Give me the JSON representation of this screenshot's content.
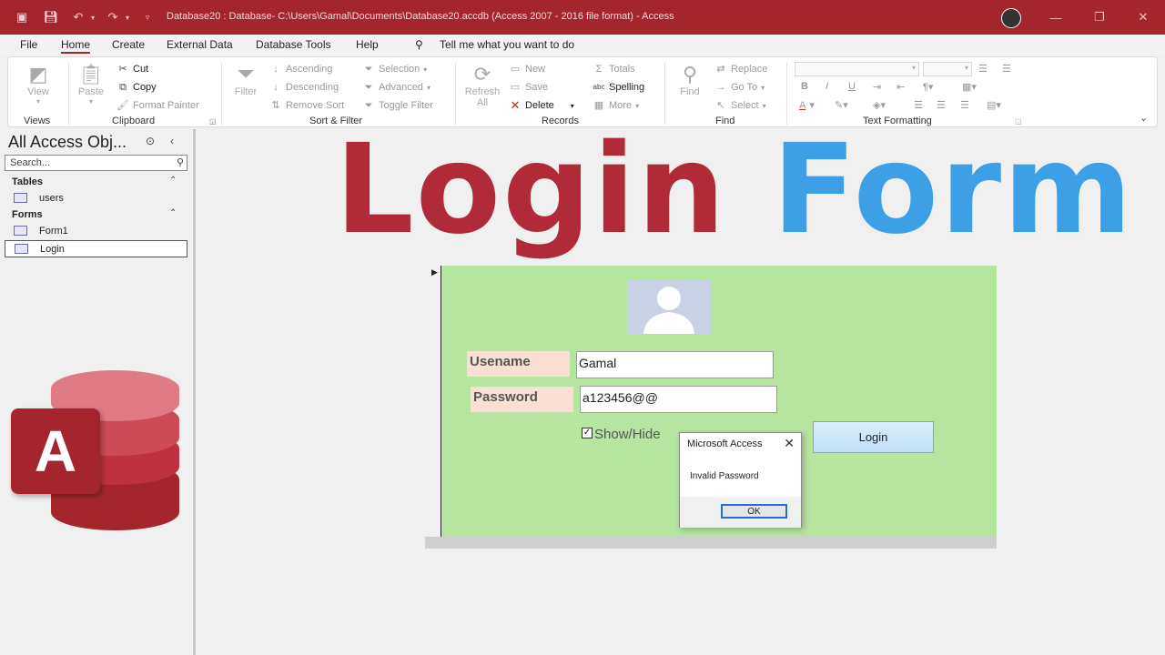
{
  "titlebar": {
    "title": "Database20 : Database- C:\\Users\\Gamal\\Documents\\Database20.accdb (Access 2007 - 2016 file format)  -  Access"
  },
  "menu": {
    "items": [
      "File",
      "Home",
      "Create",
      "External Data",
      "Database Tools",
      "Help"
    ],
    "tell_me": "Tell me what you want to do"
  },
  "ribbon": {
    "views": {
      "view": "View",
      "group": "Views"
    },
    "clipboard": {
      "paste": "Paste",
      "cut": "Cut",
      "copy": "Copy",
      "format_painter": "Format Painter",
      "group": "Clipboard"
    },
    "sort_filter": {
      "filter": "Filter",
      "ascending": "Ascending",
      "descending": "Descending",
      "remove_sort": "Remove Sort",
      "selection": "Selection",
      "advanced": "Advanced",
      "toggle_filter": "Toggle Filter",
      "group": "Sort & Filter"
    },
    "records": {
      "refresh": "Refresh",
      "refresh_all": "All",
      "new": "New",
      "save": "Save",
      "delete": "Delete",
      "totals": "Totals",
      "spelling": "Spelling",
      "more": "More",
      "group": "Records"
    },
    "find": {
      "find": "Find",
      "replace": "Replace",
      "go_to": "Go To",
      "select": "Select",
      "group": "Find"
    },
    "text_formatting": {
      "bold": "B",
      "italic": "I",
      "underline": "U",
      "group": "Text Formatting"
    }
  },
  "nav": {
    "title": "All Access Obj...",
    "search_placeholder": "Search...",
    "groups": [
      {
        "label": "Tables",
        "items": [
          "users"
        ]
      },
      {
        "label": "Forms",
        "items": [
          "Form1",
          "Login"
        ]
      }
    ]
  },
  "logo_letter": "A",
  "banner": {
    "word1": "Login",
    "word2": "Form"
  },
  "form": {
    "username_label": "Usename",
    "username_value": "Gamal",
    "password_label": "Password",
    "password_value": "a123456@@",
    "show_hide_label": "Show/Hide",
    "show_hide_checked": true,
    "login_button": "Login"
  },
  "dialog": {
    "title": "Microsoft Access",
    "message": "Invalid Password",
    "ok": "OK"
  },
  "colors": {
    "brand": "#a4262c",
    "banner_word1": "#b02a37",
    "banner_word2": "#3d9fe6",
    "form_background": "#b6e5a0",
    "label_background": "#f8e0d4"
  }
}
